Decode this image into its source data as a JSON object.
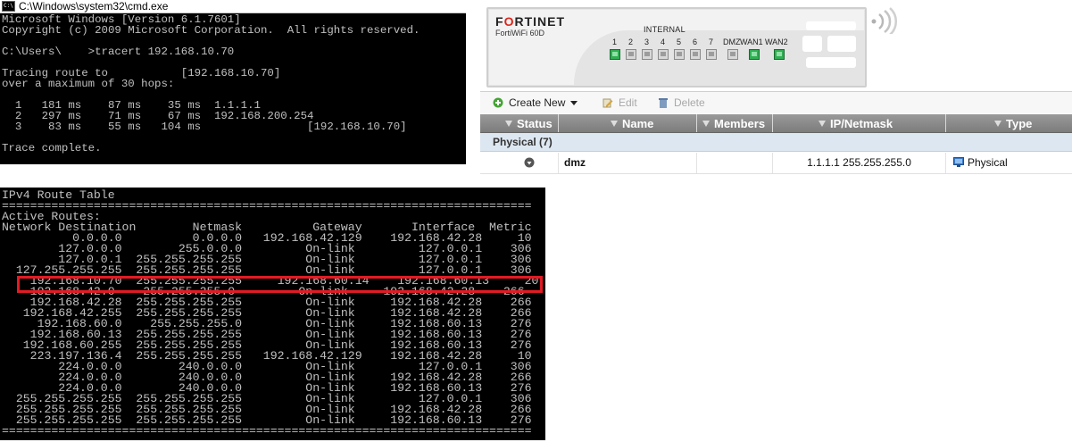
{
  "cmd": {
    "title": "C:\\Windows\\system32\\cmd.exe",
    "lines": [
      "Microsoft Windows [Version 6.1.7601]",
      "Copyright (c) 2009 Microsoft Corporation.  All rights reserved.",
      "",
      "C:\\Users\\    >tracert 192.168.10.70",
      "",
      "Tracing route to           [192.168.10.70]",
      "over a maximum of 30 hops:",
      "",
      "  1   181 ms    87 ms    35 ms  1.1.1.1",
      "  2   297 ms    71 ms    67 ms  192.168.200.254",
      "  3    83 ms    55 ms   104 ms                [192.168.10.70]",
      "",
      "Trace complete."
    ]
  },
  "device": {
    "brand": "FORTINET",
    "model": "FortiWiFi 60D",
    "internal_label": "INTERNAL",
    "ports": [
      {
        "label": "1",
        "active": true
      },
      {
        "label": "2",
        "active": false
      },
      {
        "label": "3",
        "active": false
      },
      {
        "label": "4",
        "active": false
      },
      {
        "label": "5",
        "active": false
      },
      {
        "label": "6",
        "active": false
      },
      {
        "label": "7",
        "active": false
      },
      {
        "label": "DMZ",
        "active": false
      },
      {
        "label": "WAN1",
        "active": true
      },
      {
        "label": "WAN2",
        "active": true
      }
    ]
  },
  "toolbar": {
    "create_new": "Create New",
    "edit": "Edit",
    "delete": "Delete"
  },
  "grid": {
    "columns": [
      "Status",
      "Name",
      "Members",
      "IP/Netmask",
      "Type"
    ],
    "group": "Physical (7)",
    "row": {
      "name": "dmz",
      "members": "",
      "ip_netmask": "1.1.1.1 255.255.255.0",
      "type": "Physical"
    }
  },
  "route_table": {
    "lines": [
      "IPv4 Route Table",
      "===========================================================================",
      "Active Routes:",
      "Network Destination        Netmask          Gateway       Interface  Metric",
      "          0.0.0.0          0.0.0.0   192.168.42.129    192.168.42.28     10",
      "        127.0.0.0        255.0.0.0         On-link         127.0.0.1    306",
      "        127.0.0.1  255.255.255.255         On-link         127.0.0.1    306",
      "  127.255.255.255  255.255.255.255         On-link         127.0.0.1    306",
      "    192.168.10.70  255.255.255.255     192.168.60.14    192.168.60.13     20",
      "    192.168.42.0    255.255.255.0         On-link     192.168.42.28    266",
      "    192.168.42.28  255.255.255.255         On-link     192.168.42.28    266",
      "   192.168.42.255  255.255.255.255         On-link     192.168.42.28    266",
      "     192.168.60.0    255.255.255.0         On-link     192.168.60.13    276",
      "    192.168.60.13  255.255.255.255         On-link     192.168.60.13    276",
      "   192.168.60.255  255.255.255.255         On-link     192.168.60.13    276",
      "    223.197.136.4  255.255.255.255   192.168.42.129    192.168.42.28     10",
      "        224.0.0.0        240.0.0.0         On-link         127.0.0.1    306",
      "        224.0.0.0        240.0.0.0         On-link     192.168.42.28    266",
      "        224.0.0.0        240.0.0.0         On-link     192.168.60.13    276",
      "  255.255.255.255  255.255.255.255         On-link         127.0.0.1    306",
      "  255.255.255.255  255.255.255.255         On-link     192.168.42.28    266",
      "  255.255.255.255  255.255.255.255         On-link     192.168.60.13    276",
      "==========================================================================="
    ],
    "highlight_color": "#e21b24"
  },
  "colors": {
    "console_bg": "#000000",
    "console_fg": "#c0c0c0",
    "port_active": "#2fae52",
    "grid_header": "#888888",
    "group_row": "#dde7f1"
  }
}
